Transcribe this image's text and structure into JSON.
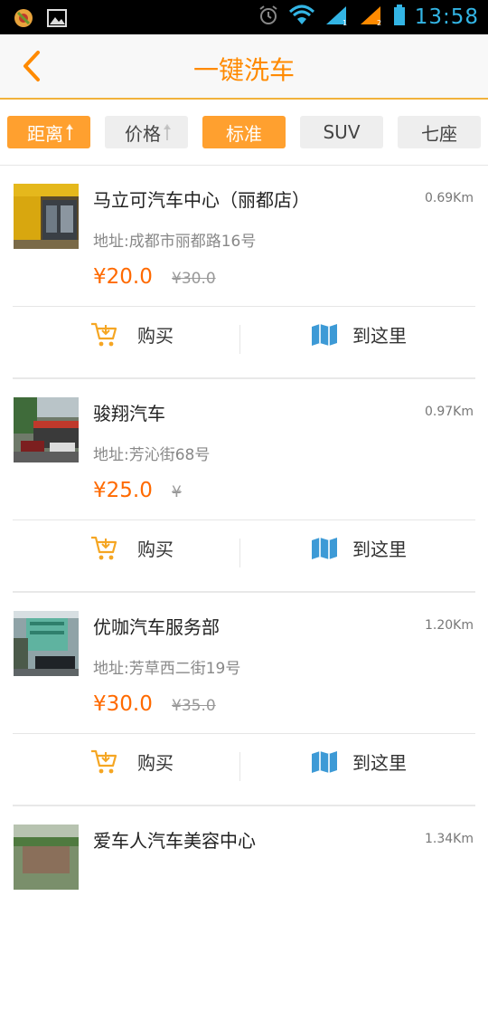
{
  "status_bar": {
    "time": "13:58"
  },
  "header": {
    "title": "一键洗车"
  },
  "filters": [
    "距离",
    "价格",
    "标准",
    "SUV",
    "七座"
  ],
  "shops": [
    {
      "name": "马立可汽车中心（丽都店）",
      "distance": "0.69Km",
      "address": "地址:成都市丽都路16号",
      "price": "¥20.0",
      "original_price": "¥30.0"
    },
    {
      "name": "骏翔汽车",
      "distance": "0.97Km",
      "address": "地址:芳沁街68号",
      "price": "¥25.0",
      "original_price": "¥"
    },
    {
      "name": "优咖汽车服务部",
      "distance": "1.20Km",
      "address": "地址:芳草西二街19号",
      "price": "¥30.0",
      "original_price": "¥35.0"
    },
    {
      "name": "爱车人汽车美容中心",
      "distance": "1.34Km",
      "address": "",
      "price": "",
      "original_price": ""
    }
  ],
  "actions": {
    "buy_label": "购买",
    "navigate_label": "到这里"
  },
  "colors": {
    "accent": "#ff8a00",
    "active_filter": "#ffa02f",
    "price": "#ff6a00",
    "status_blue": "#33b5e5"
  }
}
